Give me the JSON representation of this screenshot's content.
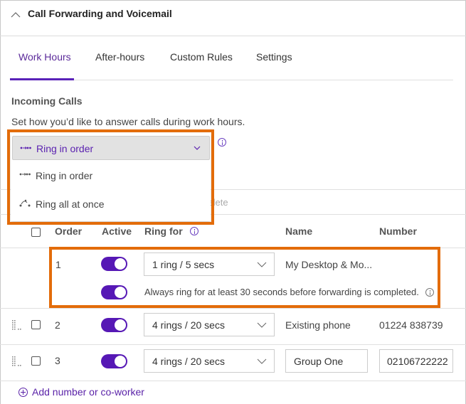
{
  "header": {
    "title": "Call Forwarding and Voicemail",
    "collapse_icon": "chevron-up-icon"
  },
  "tabs": [
    {
      "label": "Work Hours",
      "active": true
    },
    {
      "label": "After-hours",
      "active": false
    },
    {
      "label": "Custom Rules",
      "active": false
    },
    {
      "label": "Settings",
      "active": false
    }
  ],
  "incoming": {
    "title": "Incoming Calls",
    "description": "Set how you’d like to answer calls during work hours."
  },
  "ring_mode": {
    "selected": "Ring in order",
    "options": [
      {
        "label": "Ring in order",
        "icon": "ring-in-order-icon"
      },
      {
        "label": "Ring all at once",
        "icon": "ring-all-icon"
      }
    ]
  },
  "toolbar": {
    "delete_label": "Delete"
  },
  "table": {
    "columns": {
      "order": "Order",
      "active": "Active",
      "ring_for": "Ring for",
      "name": "Name",
      "number": "Number"
    },
    "rows": [
      {
        "order": "1",
        "active": true,
        "ring_for": "1 ring / 5 secs",
        "name": "My Desktop & Mo...",
        "number": "",
        "extra": {
          "active": true,
          "text": "Always ring for at least 30 seconds before forwarding is completed."
        }
      },
      {
        "order": "2",
        "active": true,
        "ring_for": "4 rings / 20 secs",
        "name": "Existing phone",
        "number": "01224 838739"
      },
      {
        "order": "3",
        "active": true,
        "ring_for": "4 rings / 20 secs",
        "name": "Group One",
        "number": "02106722222"
      }
    ]
  },
  "add_link": "Add number or co-worker",
  "colors": {
    "accent": "#5618b5",
    "highlight": "#e36c0a"
  }
}
